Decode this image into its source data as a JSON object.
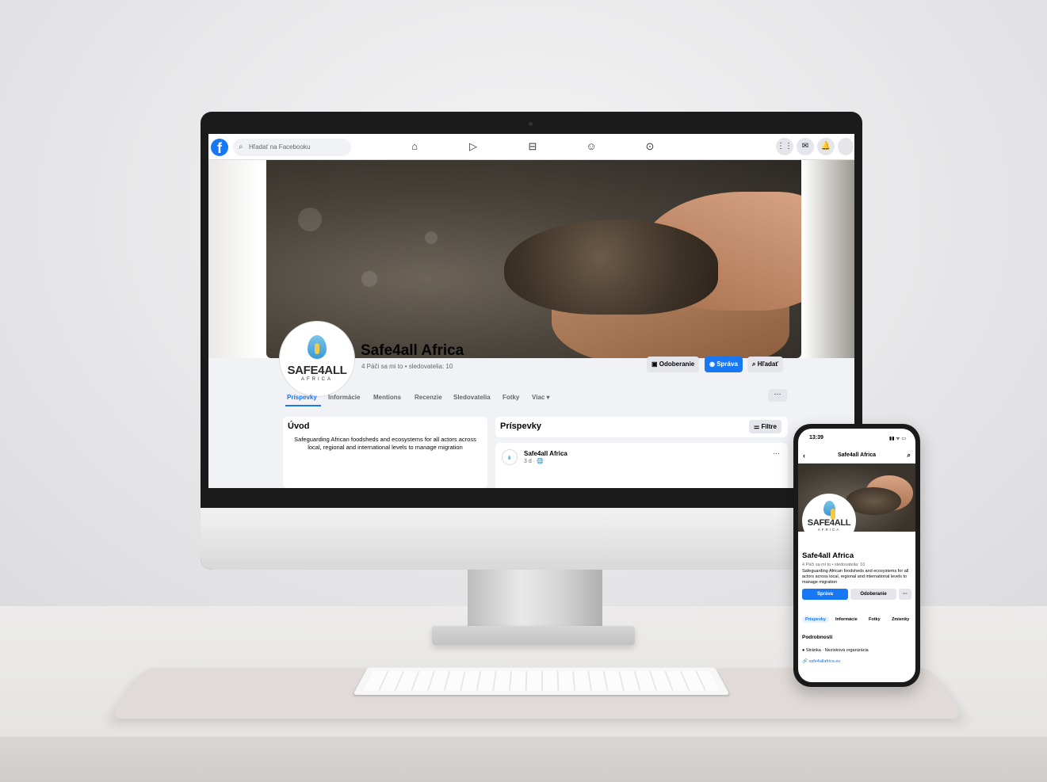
{
  "facebook": {
    "logo_glyph": "f",
    "search": {
      "icon": "search-icon",
      "placeholder": "Hľadať na Facebooku"
    },
    "nav_icons": [
      "home-icon",
      "video-icon",
      "marketplace-icon",
      "groups-icon",
      "gaming-icon"
    ],
    "right_icons": [
      "menu-grid-icon",
      "messenger-icon",
      "notifications-icon",
      "account-avatar"
    ]
  },
  "page": {
    "name": "Safe4all Africa",
    "stats": "4 Páči sa mi to • sledovatelia: 10",
    "logo": {
      "main": "SAFE4ALL",
      "sub": "AFRICA"
    },
    "buttons": {
      "subscribe": "Odoberanie",
      "message": "Správa",
      "search": "Hľadať"
    },
    "tabs": [
      "Príspevky",
      "Informácie",
      "Mentions",
      "Recenzie",
      "Sledovatelia",
      "Fotky",
      "Viac ▾"
    ],
    "more": "···",
    "intro": {
      "title": "Úvod",
      "text": "Safeguarding African foodsheds and ecosystems for all actors across local, regional and international levels to manage migration"
    },
    "posts": {
      "title": "Príspevky",
      "filter": "Filtre",
      "first_post": {
        "author": "Safe4all Africa",
        "time": "3 d · 🌐",
        "menu": "···"
      }
    }
  },
  "phone": {
    "time": "13:39",
    "status": "▮▮ ᯤ ▭",
    "header": "Safe4all Africa",
    "name": "Safe4all Africa",
    "stats": "4 Páči sa mi to • sledovatelia: 10",
    "description": "Safeguarding African foodsheds and ecosystems for all actors across local, regional and international levels to manage migration",
    "buttons": {
      "message": "Správa",
      "subscribe": "Odoberanie",
      "more": "···"
    },
    "tabs": [
      "Príspevky",
      "Informácie",
      "Fotky",
      "Zmienky"
    ],
    "details_title": "Podrobnosti",
    "details": [
      {
        "icon": "info-icon",
        "text": "Stránka · Nezisková organizácia"
      },
      {
        "icon": "link-icon",
        "text": "safe4allafrica.eu"
      }
    ]
  },
  "colors": {
    "fb_blue": "#1877f2",
    "text": "#050505",
    "muted": "#65676b"
  }
}
